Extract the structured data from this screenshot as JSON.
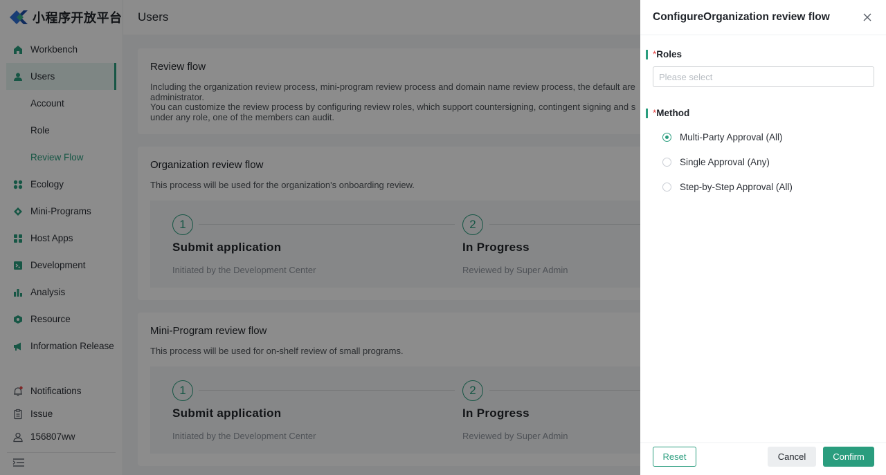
{
  "brand": {
    "name": "小程序开放平台"
  },
  "sidebar": {
    "items": [
      {
        "label": "Workbench",
        "icon": "home-icon"
      },
      {
        "label": "Users",
        "icon": "user-icon",
        "active": true
      },
      {
        "label": "Account",
        "sub": true
      },
      {
        "label": "Role",
        "sub": true
      },
      {
        "label": "Review Flow",
        "sub": true,
        "active": true
      },
      {
        "label": "Ecology",
        "icon": "grid-icon"
      },
      {
        "label": "Mini-Programs",
        "icon": "diamond-icon"
      },
      {
        "label": "Host Apps",
        "icon": "apps-icon"
      },
      {
        "label": "Development",
        "icon": "terminal-icon"
      },
      {
        "label": "Analysis",
        "icon": "bar-chart-icon"
      },
      {
        "label": "Resource",
        "icon": "resource-icon"
      },
      {
        "label": "Information Release",
        "icon": "megaphone-icon"
      }
    ],
    "bottom": [
      {
        "label": "Notifications",
        "icon": "bell-icon"
      },
      {
        "label": "Issue",
        "icon": "clipboard-icon"
      },
      {
        "label": "156807ww",
        "icon": "profile-icon"
      }
    ]
  },
  "header": {
    "title": "Users"
  },
  "review_flow": {
    "title": "Review flow",
    "desc_line1": "Including the organization review process, mini-program review process and domain name review process, the default are",
    "desc_line2": "administrator.",
    "desc_line3": "You can customize the review process by configuring review roles, which support countersigning, contingent signing and s",
    "desc_line4": "under any role, one of the members can audit."
  },
  "org_flow": {
    "title": "Organization review flow",
    "desc": "This process will be used for the organization's onboarding review.",
    "steps": [
      {
        "num": "1",
        "title": "Submit application",
        "desc": "Initiated by the Development Center"
      },
      {
        "num": "2",
        "title": "In Progress",
        "desc": "Reviewed by Super Admin"
      }
    ]
  },
  "mini_flow": {
    "title": "Mini-Program review flow",
    "desc": "This process will be used for on-shelf review of small programs.",
    "steps": [
      {
        "num": "1",
        "title": "Submit application",
        "desc": "Initiated by the Development Center"
      },
      {
        "num": "2",
        "title": "In Progress",
        "desc": "Reviewed by Super Admin"
      }
    ]
  },
  "drawer": {
    "title": "ConfigureOrganization review flow",
    "roles_label": "Roles",
    "roles_placeholder": "Please select",
    "method_label": "Method",
    "required_mark": "*",
    "methods": [
      {
        "label": "Multi-Party Approval (All)",
        "checked": true
      },
      {
        "label": "Single Approval (Any)",
        "checked": false
      },
      {
        "label": "Step-by-Step Approval (All)",
        "checked": false
      }
    ],
    "reset_label": "Reset",
    "cancel_label": "Cancel",
    "confirm_label": "Confirm"
  },
  "colors": {
    "accent": "#2a9d7e",
    "required": "#e54545"
  }
}
